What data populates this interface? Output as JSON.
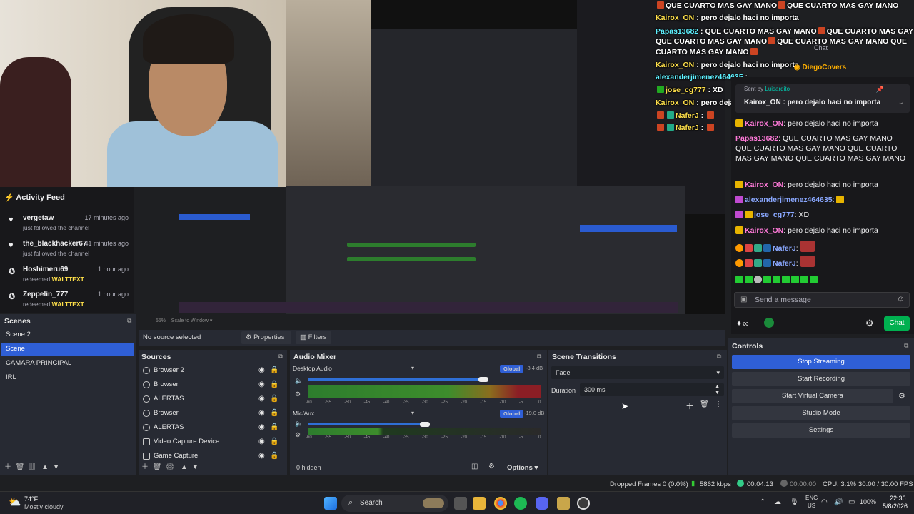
{
  "overlay_chat": [
    {
      "user": "",
      "text": "QUE CUARTO MAS GAY MANO",
      "repeat": "QUE CUARTO MAS GAY MANO"
    },
    {
      "user": "Kairox_ON",
      "text": "pero dejalo haci no importa"
    },
    {
      "user": "Papas13682",
      "text": "QUE CUARTO MAS GAY MANO",
      "repeat": "QUE CUARTO MAS GAY MANO"
    },
    {
      "user": "",
      "text": "QUE CUARTO MAS GAY MANO",
      "repeat": "QUE CUARTO MAS GAY MANO QUE"
    },
    {
      "user": "",
      "text": "CUARTO MAS GAY MANO"
    },
    {
      "user": "Kairox_ON",
      "text": "pero dejalo haci no importa"
    },
    {
      "user": "alexanderjimenez464635",
      "text": ""
    },
    {
      "user": "jose_cg777",
      "text": "XD"
    },
    {
      "user": "Kairox_ON",
      "text": "pero dejalo haci no importa"
    },
    {
      "user": "NaferJ",
      "text": ""
    },
    {
      "user": "NaferJ",
      "text": ""
    }
  ],
  "twitch_chat": {
    "header": "Chat",
    "pinned_user": "DiegoCovers",
    "sent_by": "Sent by",
    "sent_by_user": "Luisardito",
    "pinned_text_user": "Kairox_ON",
    "pinned_text": "pero dejalo haci no importa",
    "messages": [
      {
        "user": "Kairox_ON",
        "text": "pero dejalo haci no importa"
      },
      {
        "user": "Papas13682",
        "text": "QUE CUARTO MAS GAY MANO QUE CUARTO MAS GAY MANO QUE CUARTO MAS GAY MANO QUE CUARTO MAS GAY MANO"
      },
      {
        "user": "Kairox_ON",
        "text": "pero dejalo haci no importa"
      },
      {
        "user": "alexanderjimenez464635",
        "text": ""
      },
      {
        "user": "jose_cg777",
        "text": "XD"
      },
      {
        "user": "Kairox_ON",
        "text": "pero dejalo haci no importa"
      },
      {
        "user": "NaferJ",
        "text": ""
      },
      {
        "user": "NaferJ",
        "text": ""
      }
    ],
    "input_placeholder": "Send a message",
    "chat_button": "Chat"
  },
  "activity_feed": {
    "title": "Activity Feed",
    "items": [
      {
        "user": "vergetaw",
        "time": "17 minutes ago",
        "desc": "just followed the channel",
        "reward": "",
        "icon": "heart-icon"
      },
      {
        "user": "the_blackhacker67",
        "time": "41 minutes ago",
        "desc": "just followed the channel",
        "reward": "",
        "icon": "heart-icon"
      },
      {
        "user": "Hoshimeru69",
        "time": "1 hour ago",
        "desc": "redeemed",
        "reward": "WALTTEXT",
        "icon": "reward-icon"
      },
      {
        "user": "Zeppelin_777",
        "time": "1 hour ago",
        "desc": "redeemed",
        "reward": "WALTTEXT",
        "icon": "reward-icon"
      }
    ]
  },
  "preview": {
    "zoom": "55%",
    "scale": "Scale to Window"
  },
  "source_bar": {
    "no_source": "No source selected",
    "properties": "Properties",
    "filters": "Filters"
  },
  "scenes": {
    "title": "Scenes",
    "items": [
      "Scene 2",
      "Scene",
      "CAMARA PRINCIPAL",
      "IRL"
    ],
    "selected": 1
  },
  "sources": {
    "title": "Sources",
    "items": [
      "Browser 2",
      "Browser",
      "ALERTAS",
      "Browser",
      "ALERTAS",
      "Video Capture Device",
      "Game Capture"
    ]
  },
  "mixer": {
    "title": "Audio Mixer",
    "channels": [
      {
        "name": "Desktop Audio",
        "db": "-8.4 dB",
        "global": "Global",
        "level": 0.75
      },
      {
        "name": "Mic/Aux",
        "db": "-19.0 dB",
        "global": "Global",
        "level": 0.5
      }
    ],
    "ticks": [
      "-60",
      "-55",
      "-50",
      "-45",
      "-40",
      "-35",
      "-30",
      "-25",
      "-20",
      "-15",
      "-10",
      "-5",
      "0"
    ],
    "hidden": "0 hidden",
    "options": "Options"
  },
  "transitions": {
    "title": "Scene Transitions",
    "type": "Fade",
    "duration_label": "Duration",
    "duration": "300 ms"
  },
  "controls": {
    "title": "Controls",
    "buttons": [
      "Stop Streaming",
      "Start Recording",
      "Start Virtual Camera",
      "Studio Mode",
      "Settings"
    ]
  },
  "status": {
    "dropped": "Dropped Frames 0 (0.0%)",
    "kbps": "5862 kbps",
    "stream_time": "00:04:13",
    "rec_time": "00:00:00",
    "cpu": "CPU: 3.1%",
    "fps": "30.00 / 30.00 FPS"
  },
  "taskbar": {
    "weather_temp": "74°F",
    "weather_desc": "Mostly cloudy",
    "search": "Search",
    "lang": "ENG",
    "region": "US",
    "battery": "100%",
    "time": "22:36",
    "date": "5/8/2026"
  },
  "colors": {
    "accent": "#2f5fd6",
    "twitch": "#9147ff",
    "chat_button": "#00b050"
  }
}
